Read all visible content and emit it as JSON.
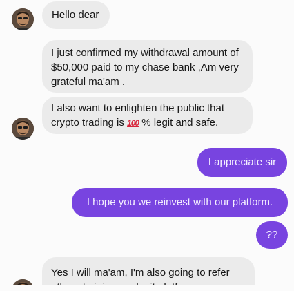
{
  "messages": [
    {
      "from": "them",
      "text": "Hello dear"
    },
    {
      "from": "them",
      "text": "I just confirmed my withdrawal amount of $50,000 paid to my chase bank ,Am very grateful ma'am ."
    },
    {
      "from": "them",
      "text_before": "I also want to enlighten the public that crypto trading is",
      "emoji": "100",
      "emoji_icon": "hundred-points-icon",
      "text_after": "% legit and safe."
    },
    {
      "from": "me",
      "text": "I appreciate sir"
    },
    {
      "from": "me",
      "text": "I hope you we reinvest with our platform."
    },
    {
      "from": "me",
      "text": "??"
    },
    {
      "from": "them",
      "text": "Yes I will ma'am, I'm  also going to refer others to join your legit platform ."
    }
  ],
  "colors": {
    "incoming_bubble": "#ebebeb",
    "outgoing_bubble": "#7844e0",
    "background": "#fbfbfb"
  }
}
